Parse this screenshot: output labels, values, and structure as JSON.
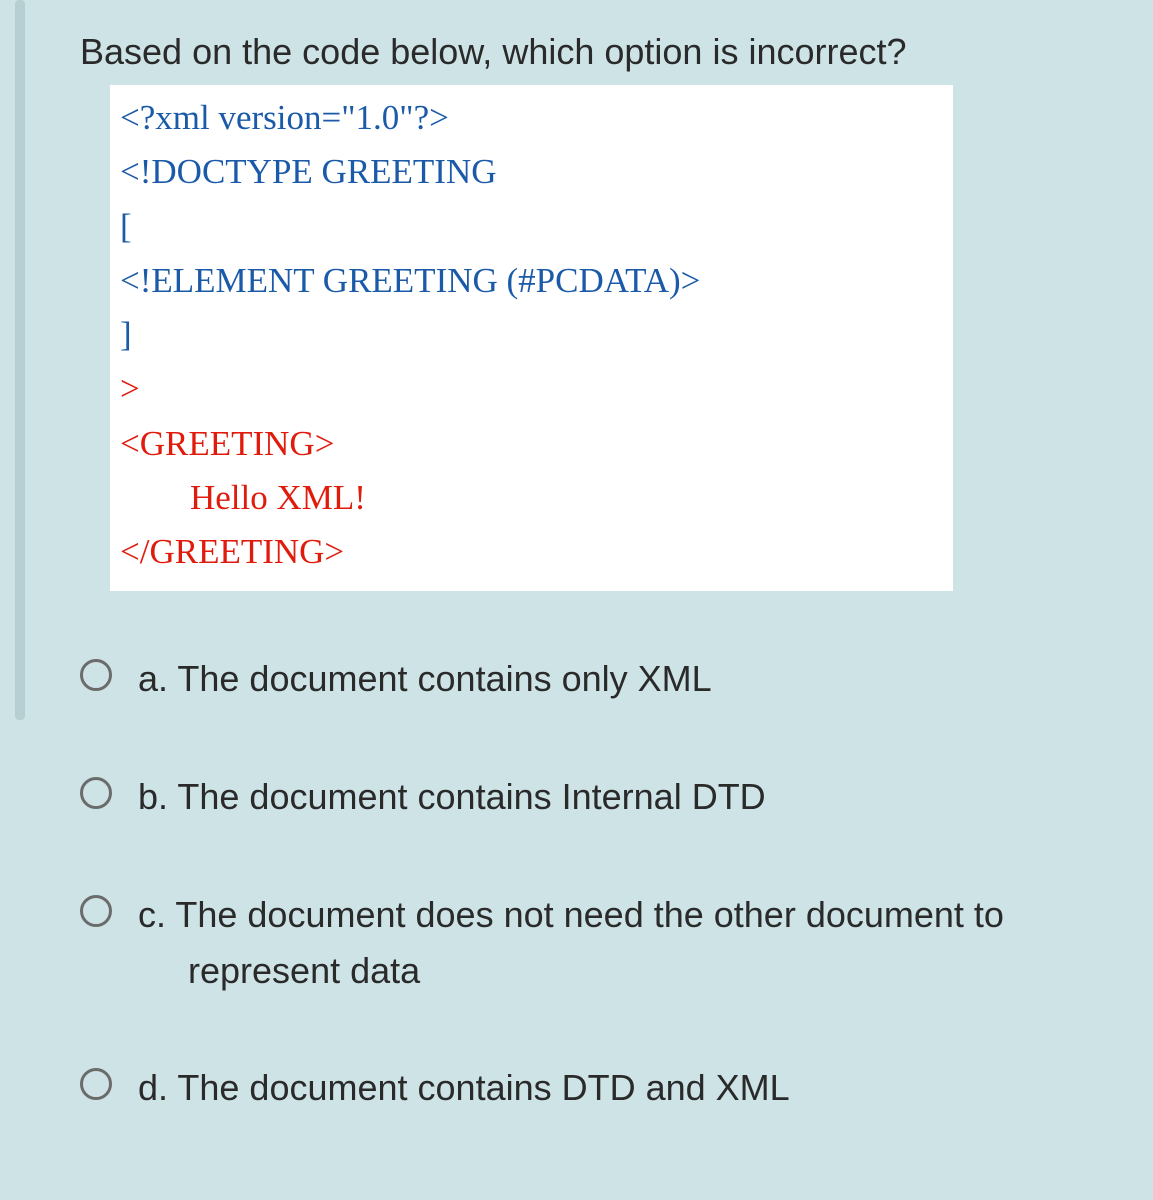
{
  "question": "Based on the code below, which option is incorrect?",
  "code": {
    "l1": "<?xml version=\"1.0\"?>",
    "l2": "<!DOCTYPE GREETING",
    "l3": "[",
    "l4": "<!ELEMENT GREETING (#PCDATA)>",
    "l5": "]",
    "l6": ">",
    "l7": "<GREETING>",
    "l8": "Hello XML!",
    "l9": "</GREETING>"
  },
  "options": {
    "a": {
      "letter": "a.",
      "text": "The document contains only XML"
    },
    "b": {
      "letter": "b.",
      "text": "The document contains Internal DTD"
    },
    "c": {
      "letter": "c.",
      "text": "The document does not need the other document to represent data"
    },
    "d": {
      "letter": "d.",
      "text": "The document contains DTD and XML"
    }
  }
}
